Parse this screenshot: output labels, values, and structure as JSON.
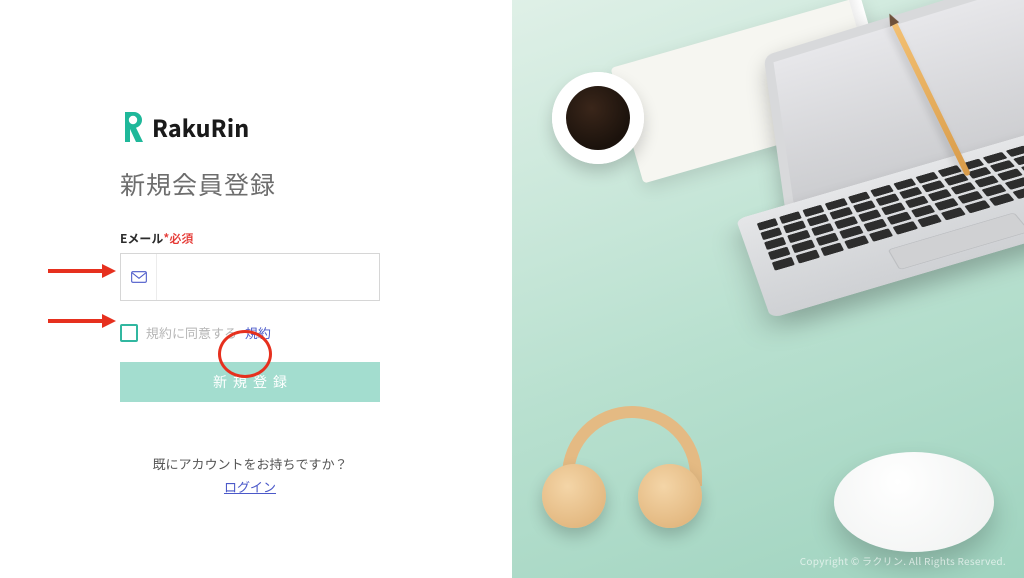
{
  "brand": {
    "name": "RakuRin"
  },
  "title": "新規会員登録",
  "email": {
    "label": "Eメール",
    "required_mark": "*必須",
    "value": "",
    "placeholder": ""
  },
  "terms": {
    "checked": false,
    "text": "規約に同意する",
    "link_label": "規約"
  },
  "submit": {
    "label": "新規登録"
  },
  "login_prompt": {
    "text": "既にアカウントをお持ちですか？",
    "link_label": "ログイン"
  },
  "colors": {
    "accent": "#31b7a0",
    "link": "#4b59c9",
    "danger": "#e53935",
    "annotation": "#e6301e"
  },
  "footer": {
    "copyright": "Copyright © ラクリン. All Rights Reserved."
  }
}
